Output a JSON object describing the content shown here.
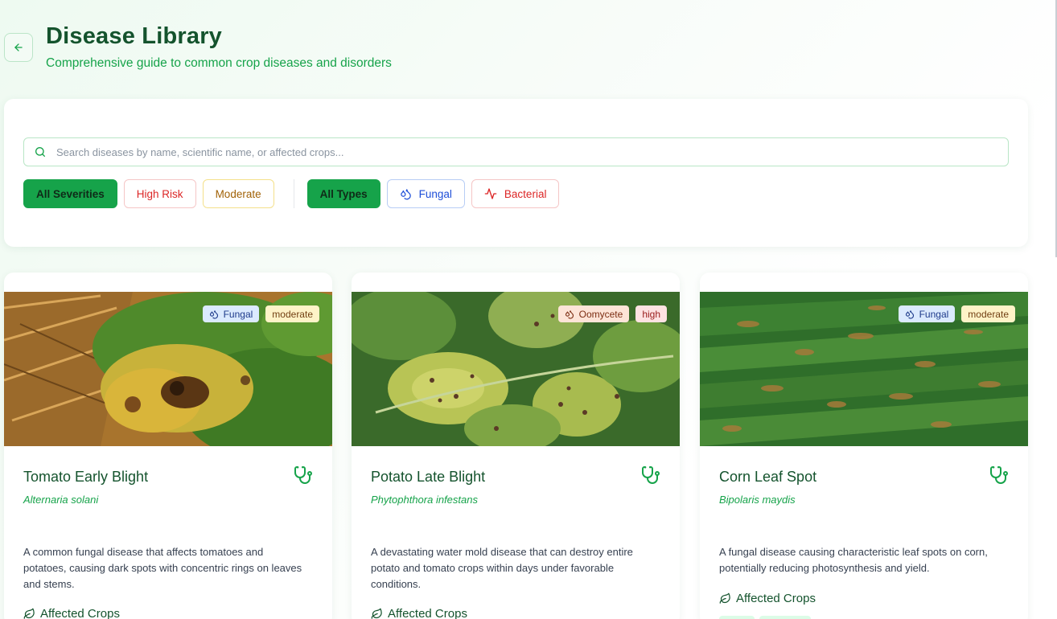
{
  "header": {
    "title": "Disease Library",
    "subtitle": "Comprehensive guide to common crop diseases and disorders",
    "back_icon": "arrow-left-icon"
  },
  "search": {
    "placeholder": "Search diseases by name, scientific name, or affected crops...",
    "value": "",
    "icon": "search-icon"
  },
  "severity_filters": [
    {
      "label": "All Severities",
      "active": true
    },
    {
      "label": "High Risk",
      "active": false
    },
    {
      "label": "Moderate",
      "active": false
    }
  ],
  "type_filters": [
    {
      "label": "All Types",
      "active": true,
      "icon": ""
    },
    {
      "label": "Fungal",
      "active": false,
      "icon": "droplets-icon"
    },
    {
      "label": "Bacterial",
      "active": false,
      "icon": "activity-icon"
    }
  ],
  "colors": {
    "brand": "#16a34a",
    "title": "#14532d",
    "fungal_badge": "#dbeafe",
    "oomycete_badge": "#fde4d7",
    "moderate_badge": "#fef3c7",
    "high_badge": "#fde2e2"
  },
  "diseases": [
    {
      "name": "Tomato Early Blight",
      "scientific_name": "Alternaria solani",
      "type": "Fungal",
      "severity": "moderate",
      "description": "A common fungal disease that affects tomatoes and potatoes, causing dark spots with concentric rings on leaves and stems.",
      "affected_label": "Affected Crops",
      "icon": "stethoscope-icon"
    },
    {
      "name": "Potato Late Blight",
      "scientific_name": "Phytophthora infestans",
      "type": "Oomycete",
      "severity": "high",
      "description": "A devastating water mold disease that can destroy entire potato and tomato crops within days under favorable conditions.",
      "affected_label": "Affected Crops",
      "icon": "stethoscope-icon"
    },
    {
      "name": "Corn Leaf Spot",
      "scientific_name": "Bipolaris maydis",
      "type": "Fungal",
      "severity": "moderate",
      "description": "A fungal disease causing characteristic leaf spots on corn, potentially reducing photosynthesis and yield.",
      "affected_label": "Affected Crops",
      "icon": "stethoscope-icon"
    }
  ]
}
